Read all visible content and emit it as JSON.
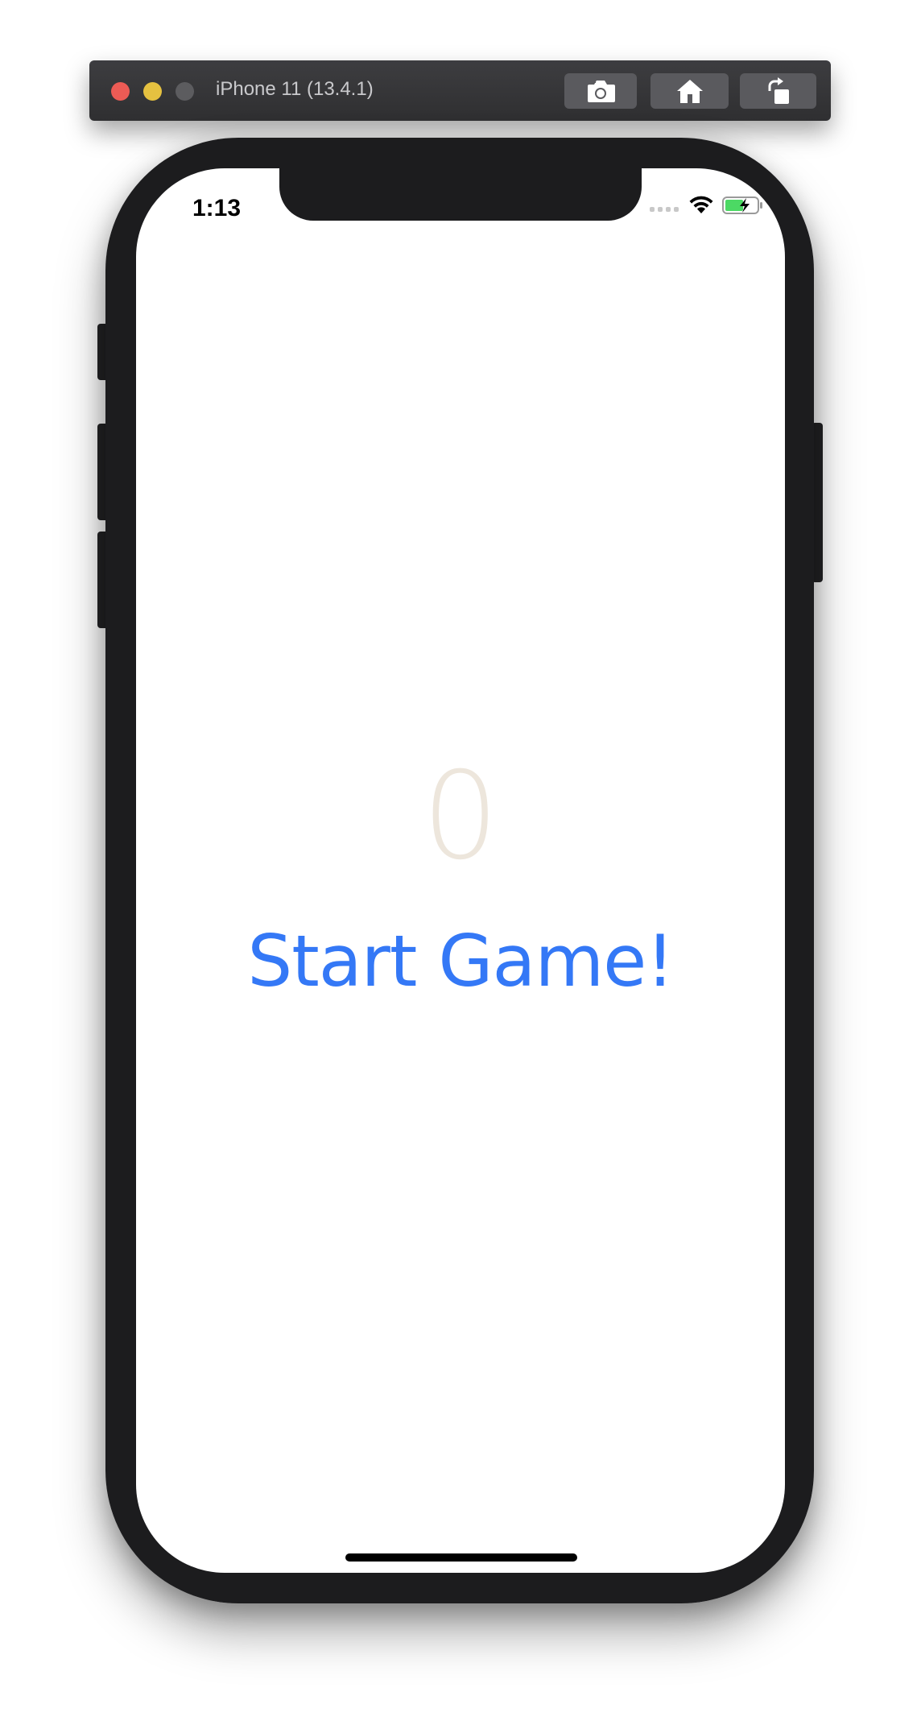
{
  "window": {
    "title": "iPhone 11 (13.4.1)",
    "toolbar": {
      "screenshot_icon": "camera-icon",
      "home_icon": "home-icon",
      "rotate_icon": "rotate-icon"
    }
  },
  "status_bar": {
    "time": "1:13",
    "signal_icon": "cellular-signal-icon",
    "wifi_icon": "wifi-icon",
    "battery_icon": "battery-charging-icon"
  },
  "game": {
    "score": "0",
    "start_button_label": "Start Game!"
  },
  "colors": {
    "score": "#ede6dc",
    "start_button": "#3478f6",
    "device_frame": "#1c1c1e",
    "battery_fill": "#4cd964"
  }
}
